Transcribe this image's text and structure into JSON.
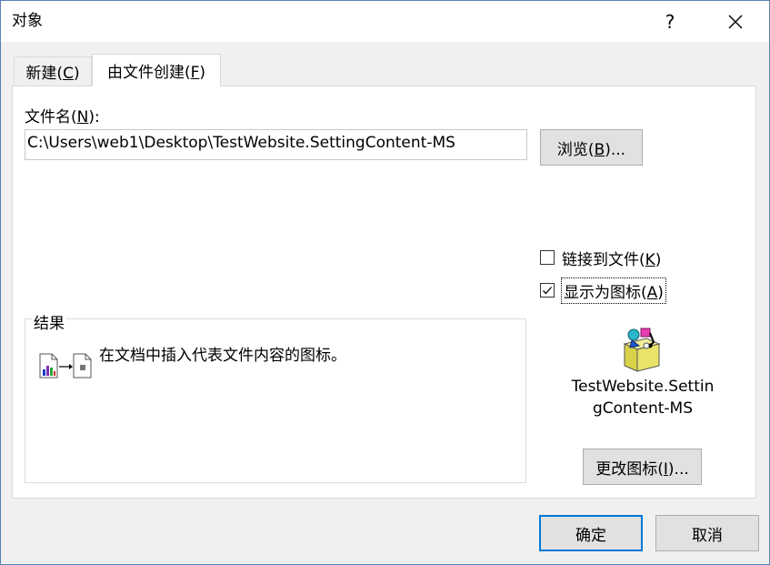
{
  "window": {
    "title": "对象",
    "help_label": "?"
  },
  "tabs": [
    {
      "label": "新建(",
      "mnemonic": "C",
      "suffix": ")"
    },
    {
      "label": "由文件创建(",
      "mnemonic": "F",
      "suffix": ")"
    }
  ],
  "file": {
    "label_prefix": "文件名(",
    "label_mnemonic": "N",
    "label_suffix": "):",
    "value": "C:\\Users\\web1\\Desktop\\TestWebsite.SettingContent-MS",
    "browse_prefix": "浏览(",
    "browse_mnemonic": "B",
    "browse_suffix": ")..."
  },
  "options": {
    "link_prefix": "链接到文件(",
    "link_mnemonic": "K",
    "link_suffix": ")",
    "link_checked": false,
    "display_prefix": "显示为图标(",
    "display_mnemonic": "A",
    "display_suffix": ")",
    "display_checked": true
  },
  "result": {
    "legend": "结果",
    "text": "在文档中插入代表文件内容的图标。"
  },
  "icon_preview": {
    "icon": "package-icon",
    "caption": "TestWebsite.SettingContent-MS"
  },
  "change_icon": {
    "prefix": "更改图标(",
    "mnemonic": "I",
    "suffix": ")..."
  },
  "footer": {
    "ok_label": "确定",
    "cancel_label": "取消"
  },
  "colors": {
    "accent": "#0078d7",
    "button_face": "#e1e1e1",
    "dialog_bg": "#f0f0f0"
  }
}
